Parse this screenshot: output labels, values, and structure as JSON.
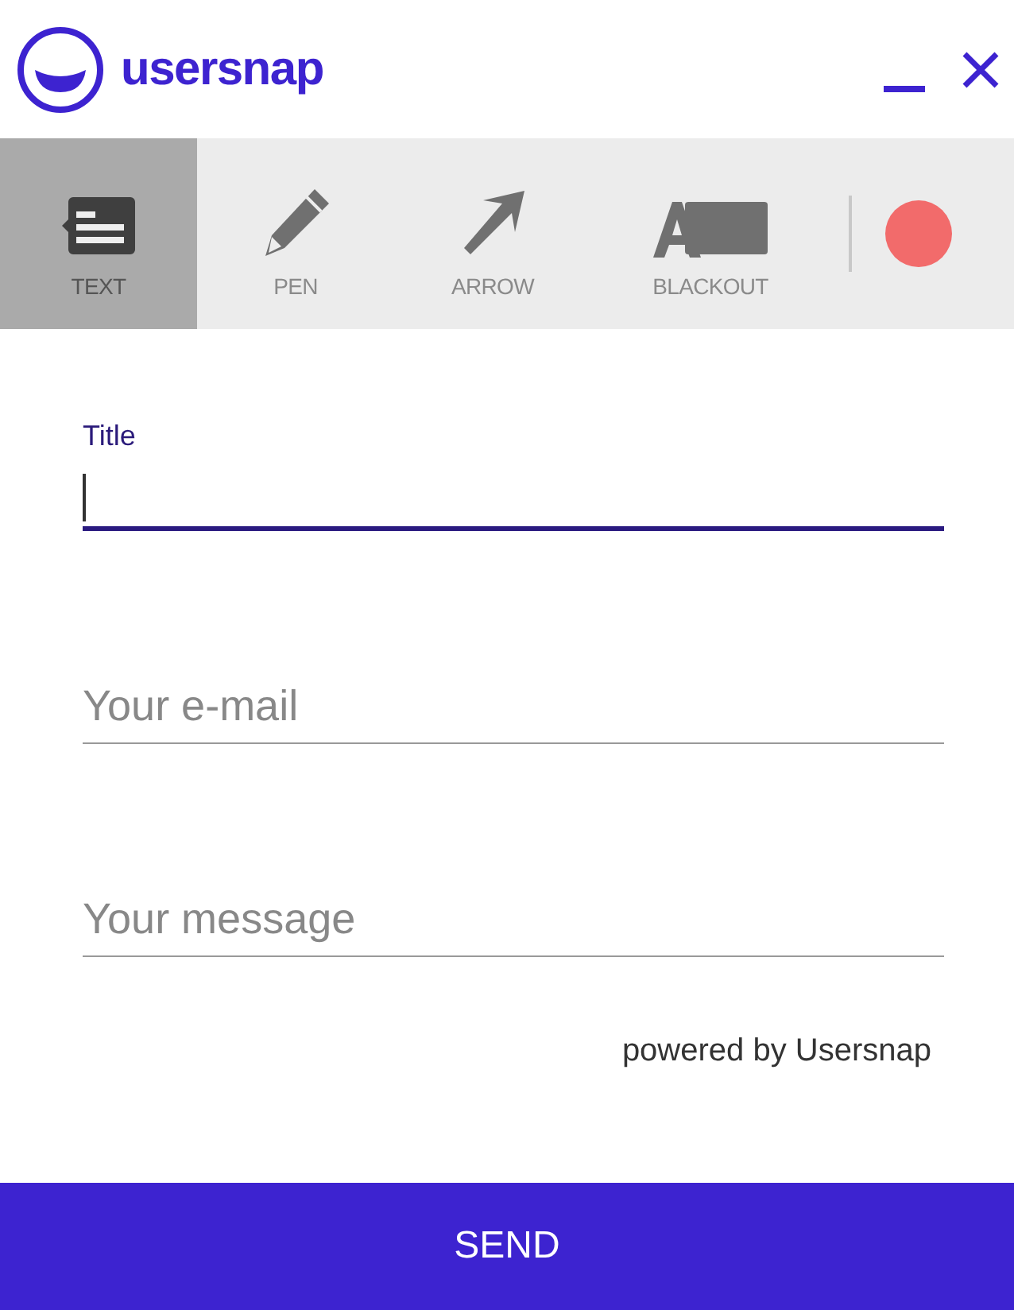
{
  "header": {
    "brand": "usersnap"
  },
  "tools": [
    {
      "kind": "text",
      "label": "TEXT",
      "selected": true
    },
    {
      "kind": "pen",
      "label": "PEN",
      "selected": false
    },
    {
      "kind": "arrow",
      "label": "ARROW",
      "selected": false
    },
    {
      "kind": "blackout",
      "label": "BLACKOUT",
      "selected": false
    }
  ],
  "fields": [
    {
      "label": "Title",
      "focused": true
    },
    {
      "placeholder": "Your e-mail",
      "focused": false
    },
    {
      "placeholder": "Your message",
      "focused": false
    }
  ],
  "footer_note": "powered by Usersnap",
  "send_button": "SEND"
}
